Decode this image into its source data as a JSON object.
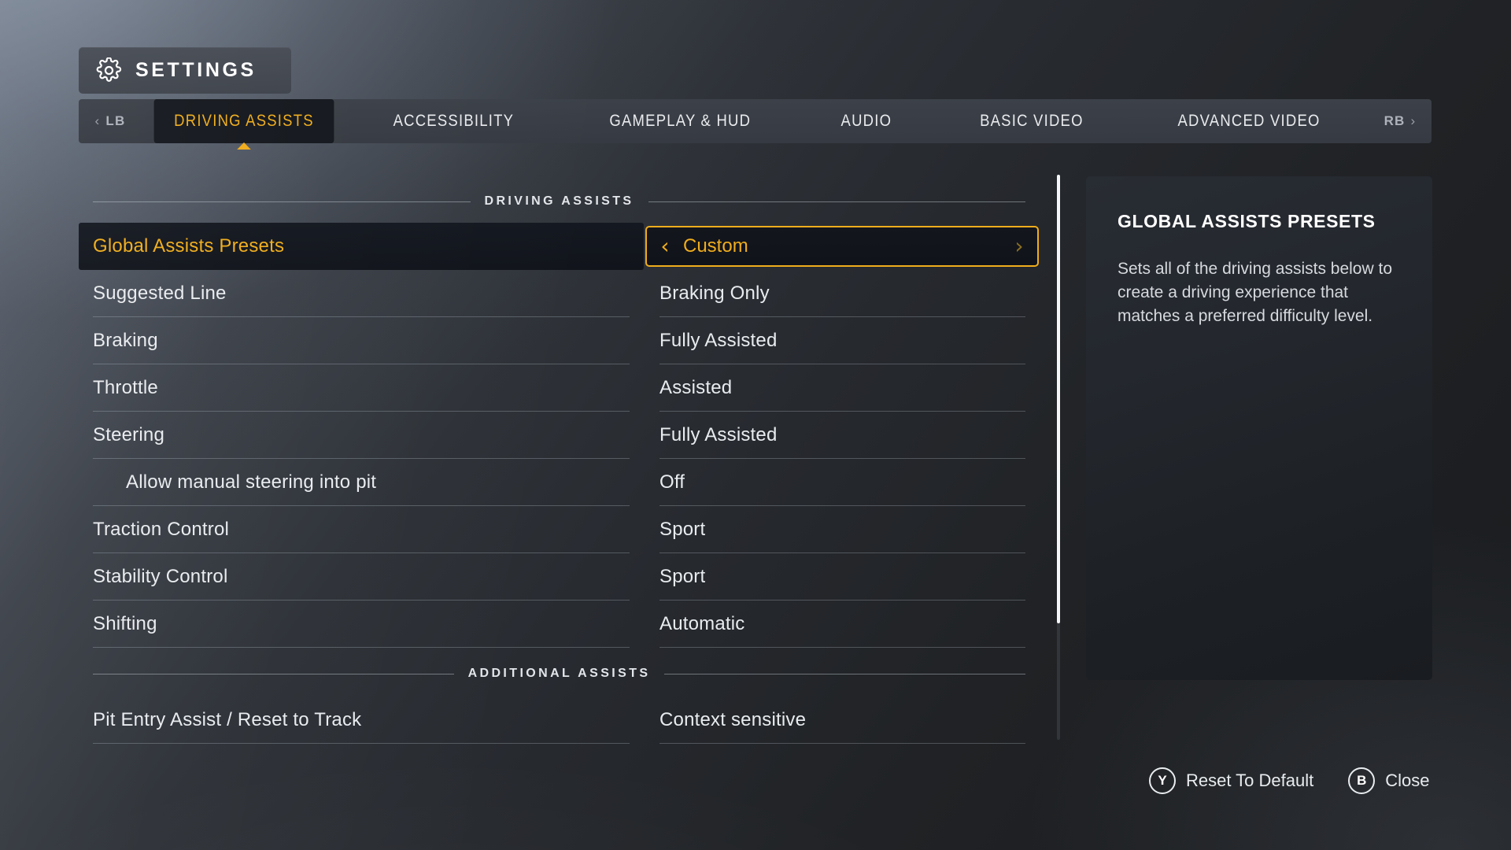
{
  "header": {
    "title": "SETTINGS",
    "gear_icon": "gear-icon"
  },
  "tabbar": {
    "left_bumper": {
      "label": "LB",
      "chevron": "‹"
    },
    "right_bumper": {
      "label": "RB",
      "chevron": "›"
    },
    "tabs": [
      {
        "label": "DRIVING ASSISTS",
        "active": true
      },
      {
        "label": "ACCESSIBILITY",
        "active": false
      },
      {
        "label": "GAMEPLAY & HUD",
        "active": false
      },
      {
        "label": "AUDIO",
        "active": false
      },
      {
        "label": "BASIC VIDEO",
        "active": false
      },
      {
        "label": "ADVANCED VIDEO",
        "active": false
      }
    ]
  },
  "sections": [
    {
      "title": "DRIVING ASSISTS"
    },
    {
      "title": "ADDITIONAL ASSISTS"
    }
  ],
  "settings": [
    {
      "label": "Global Assists Presets",
      "value": "Custom",
      "selected": true,
      "indent": false
    },
    {
      "label": "Suggested Line",
      "value": "Braking Only",
      "selected": false,
      "indent": false
    },
    {
      "label": "Braking",
      "value": "Fully Assisted",
      "selected": false,
      "indent": false
    },
    {
      "label": "Throttle",
      "value": "Assisted",
      "selected": false,
      "indent": false
    },
    {
      "label": "Steering",
      "value": "Fully Assisted",
      "selected": false,
      "indent": false
    },
    {
      "label": "Allow manual steering into pit",
      "value": "Off",
      "selected": false,
      "indent": true
    },
    {
      "label": "Traction Control",
      "value": "Sport",
      "selected": false,
      "indent": false
    },
    {
      "label": "Stability Control",
      "value": "Sport",
      "selected": false,
      "indent": false
    },
    {
      "label": "Shifting",
      "value": "Automatic",
      "selected": false,
      "indent": false
    }
  ],
  "additional_settings": [
    {
      "label": "Pit Entry Assist / Reset to Track",
      "value": "Context sensitive",
      "selected": false,
      "indent": false
    }
  ],
  "stepper": {
    "left_arrow": "‹",
    "right_arrow": "›",
    "value": "Custom"
  },
  "info_panel": {
    "title": "GLOBAL ASSISTS PRESETS",
    "description": "Sets all of the driving assists below to create a driving experience that matches a preferred difficulty level."
  },
  "footer": {
    "prompts": [
      {
        "button": "Y",
        "label": "Reset To Default"
      },
      {
        "button": "B",
        "label": "Close"
      }
    ]
  },
  "colors": {
    "accent": "#f0ad1c",
    "text": "#e9ecef",
    "selected_row_bg": "#141820",
    "panel_bg": "#23272d"
  }
}
